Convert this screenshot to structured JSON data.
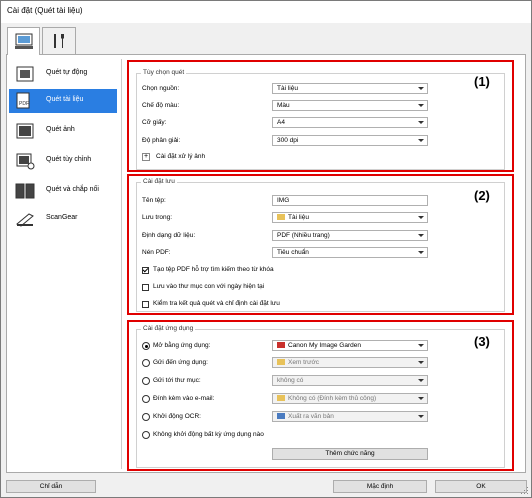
{
  "window": {
    "title": "Cài đặt (Quét tài liệu)"
  },
  "tabs": [
    {
      "name": "scan-from-computer",
      "icon": "computer-icon",
      "active": true
    },
    {
      "name": "general-settings",
      "icon": "tools-icon",
      "active": false
    }
  ],
  "sidebar": {
    "items": [
      {
        "label": "Quét tự động",
        "icon": "auto-scan-icon",
        "selected": false
      },
      {
        "label": "Quét tài liệu",
        "icon": "document-scan-icon",
        "selected": true
      },
      {
        "label": "Quét ảnh",
        "icon": "photo-scan-icon",
        "selected": false
      },
      {
        "label": "Quét tùy chỉnh",
        "icon": "custom-scan-icon",
        "selected": false
      },
      {
        "label": "Quét và chắp nối",
        "icon": "stitch-scan-icon",
        "selected": false
      },
      {
        "label": "ScanGear",
        "icon": "scangear-icon",
        "selected": false
      }
    ]
  },
  "scan_options": {
    "number": "(1)",
    "title": "Tùy chọn quét",
    "select_source_label": "Chọn nguồn:",
    "select_source_value": "Tài liệu",
    "color_mode_label": "Chế độ màu:",
    "color_mode_value": "Màu",
    "paper_size_label": "Cỡ giấy:",
    "paper_size_value": "A4",
    "resolution_label": "Độ phân giải:",
    "resolution_value": "300 dpi",
    "image_processing_label": "Cài đặt xử lý ảnh",
    "image_processing_toggle": "+"
  },
  "save_settings": {
    "number": "(2)",
    "title": "Cài đặt lưu",
    "file_name_label": "Tên tệp:",
    "file_name_value": "IMG",
    "save_in_label": "Lưu trong:",
    "save_in_value": "Tài liệu",
    "data_format_label": "Định dạng dữ liệu:",
    "data_format_value": "PDF (Nhiều trang)",
    "pdf_compression_label": "Nén PDF:",
    "pdf_compression_value": "Tiêu chuẩn",
    "checkbox_keyword_pdf": "Tạo tệp PDF hỗ trợ tìm kiếm theo từ khóa",
    "checkbox_keyword_pdf_checked": true,
    "checkbox_date_subfolder": "Lưu vào thư mục con với ngày hiện tại",
    "checkbox_date_subfolder_checked": false,
    "checkbox_check_results": "Kiểm tra kết quả quét và chỉ định cài đặt lưu",
    "checkbox_check_results_checked": false
  },
  "app_settings": {
    "number": "(3)",
    "title": "Cài đặt ứng dụng",
    "open_with_label": "Mở bằng ứng dụng:",
    "open_with_value": "Canon My Image Garden",
    "open_with_checked": true,
    "send_to_app_label": "Gửi đến ứng dụng:",
    "send_to_app_value": "Xem trước",
    "send_to_folder_label": "Gửi tới thư mục:",
    "send_to_folder_value": "không có",
    "attach_email_label": "Đính kèm vào e-mail:",
    "attach_email_value": "Không có (Đính kèm thủ công)",
    "start_ocr_label": "Khởi động OCR:",
    "start_ocr_value": "Xuất ra văn bản",
    "no_app_label": "Không khởi động bất kỳ ứng dụng nào",
    "more_functions_button": "Thêm chức năng"
  },
  "footer": {
    "instructions_button": "Chỉ dẫn",
    "defaults_button": "Mặc định",
    "ok_button": "OK"
  },
  "colors": {
    "highlight": "#e00000",
    "selection": "#2a7ee2"
  }
}
